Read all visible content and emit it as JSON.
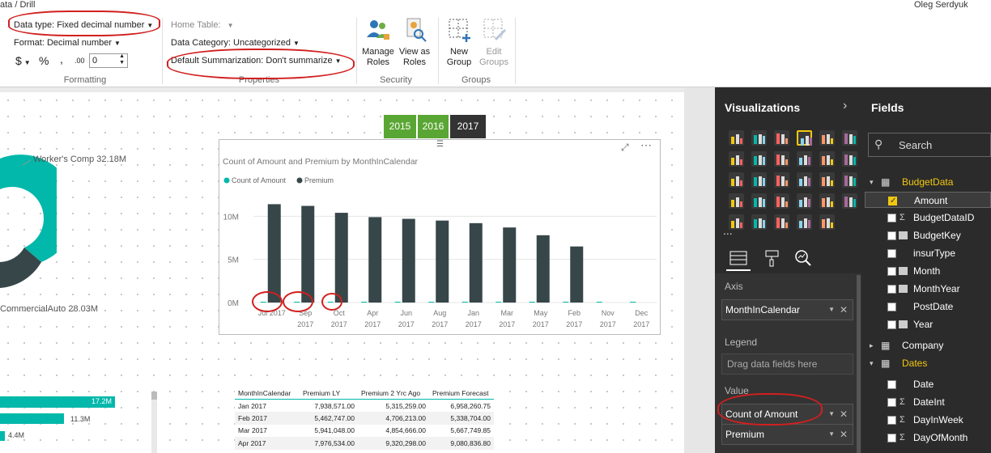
{
  "topbar": {
    "breadcrumb": "ata / Drill",
    "user": "Oleg Serdyuk"
  },
  "ribbon": {
    "data_type": "Data type: Fixed decimal number",
    "format": "Format: Decimal number",
    "currency": "$",
    "percent": "%",
    "comma": ",",
    "decimals_icon": ".00",
    "decimals_value": "0",
    "home_table": "Home Table:",
    "data_category": "Data Category: Uncategorized",
    "default_summarization": "Default Summarization: Don't summarize",
    "manage_roles": [
      "Manage",
      "Roles"
    ],
    "view_as_roles": [
      "View as",
      "Roles"
    ],
    "new_group": [
      "New",
      "Group"
    ],
    "edit_groups": [
      "Edit",
      "Groups"
    ],
    "groups": [
      "Formatting",
      "Properties",
      "Security",
      "Groups"
    ]
  },
  "donut": {
    "label_top": "Worker's Comp 32.18M",
    "label_bottom": "CommercialAuto 28.03M"
  },
  "slicer": {
    "years": [
      "2015",
      "2016",
      "2017"
    ],
    "selected": "2017"
  },
  "chart_data": {
    "type": "bar",
    "title": "Count of Amount and Premium by MonthInCalendar",
    "categories": [
      "Jul 2017",
      "Sep 2017",
      "Oct 2017",
      "Apr 2017",
      "Jun 2017",
      "Aug 2017",
      "Jan 2017",
      "Mar 2017",
      "May 2017",
      "Feb 2017",
      "Nov 2017",
      "Dec 2017"
    ],
    "tick_labels": [
      [
        "Jul 2017",
        ""
      ],
      [
        "Sep",
        "2017"
      ],
      [
        "Oct",
        "2017"
      ],
      [
        "Apr",
        "2017"
      ],
      [
        "Jun",
        "2017"
      ],
      [
        "Aug",
        "2017"
      ],
      [
        "Jan",
        "2017"
      ],
      [
        "Mar",
        "2017"
      ],
      [
        "May",
        "2017"
      ],
      [
        "Feb",
        "2017"
      ],
      [
        "Nov",
        "2017"
      ],
      [
        "Dec",
        "2017"
      ]
    ],
    "series": [
      {
        "name": "Count of Amount",
        "color": "#01b8aa",
        "values": [
          0,
          0,
          0,
          0,
          0,
          0,
          0,
          0,
          0,
          0,
          0,
          0
        ]
      },
      {
        "name": "Premium",
        "color": "#374649",
        "values": [
          11.4,
          11.2,
          10.4,
          9.9,
          9.7,
          9.5,
          9.2,
          8.7,
          7.8,
          6.5,
          0,
          0
        ]
      }
    ],
    "yticks": [
      "0M",
      "5M",
      "10M"
    ],
    "ylim": [
      0,
      12
    ],
    "legend_position": "top-left"
  },
  "bars": {
    "values": [
      "17.2M",
      "11.3M",
      "4.4M"
    ]
  },
  "matrix": {
    "columns": [
      "MonthInCalendar",
      "Premium LY",
      "Premium 2 Yrc Ago",
      "Premium Forecast"
    ],
    "rows": [
      [
        "Jan 2017",
        "7,938,571.00",
        "5,315,259.00",
        "6,958,260.75"
      ],
      [
        "Feb 2017",
        "5,462,747.00",
        "4,706,213.00",
        "5,338,704.00"
      ],
      [
        "Mar 2017",
        "5,941,048.00",
        "4,854,666.00",
        "5,667,749.85"
      ],
      [
        "Apr 2017",
        "7,976,534.00",
        "9,320,298.00",
        "9,080,836.80"
      ]
    ]
  },
  "viz": {
    "title": "Visualizations",
    "more": "...",
    "axis_label": "Axis",
    "axis_field": "MonthInCalendar",
    "legend_label": "Legend",
    "legend_placeholder": "Drag data fields here",
    "value_label": "Value",
    "value_fields": [
      "Count of Amount",
      "Premium"
    ]
  },
  "fields": {
    "title": "Fields",
    "search_placeholder": "Search",
    "tables": [
      {
        "name": "BudgetData",
        "expanded": true,
        "highlight": true
      },
      {
        "name": "Company",
        "expanded": false,
        "highlight": false
      },
      {
        "name": "Dates",
        "expanded": true,
        "highlight": true
      }
    ],
    "budget_fields": [
      {
        "name": "Amount",
        "checked": true,
        "icon": ""
      },
      {
        "name": "BudgetDataID",
        "checked": false,
        "icon": "Σ"
      },
      {
        "name": "BudgetKey",
        "checked": false,
        "icon": "cal"
      },
      {
        "name": "insurType",
        "checked": false,
        "icon": ""
      },
      {
        "name": "Month",
        "checked": false,
        "icon": "cal"
      },
      {
        "name": "MonthYear",
        "checked": false,
        "icon": "cal"
      },
      {
        "name": "PostDate",
        "checked": false,
        "icon": ""
      },
      {
        "name": "Year",
        "checked": false,
        "icon": "cal"
      }
    ],
    "date_fields": [
      {
        "name": "Date",
        "checked": false,
        "icon": ""
      },
      {
        "name": "DateInt",
        "checked": false,
        "icon": "Σ"
      },
      {
        "name": "DayInWeek",
        "checked": false,
        "icon": "Σ"
      },
      {
        "name": "DayOfMonth",
        "checked": false,
        "icon": "Σ"
      }
    ]
  }
}
